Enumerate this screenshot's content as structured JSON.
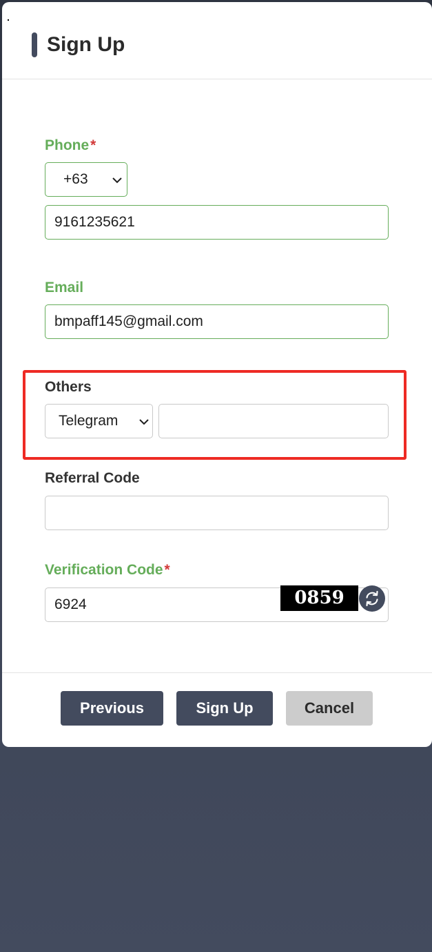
{
  "dialog": {
    "title": "Sign Up"
  },
  "form": {
    "phone": {
      "label": "Phone",
      "required_mark": "*",
      "country_code": "+63",
      "value": "9161235621"
    },
    "email": {
      "label": "Email",
      "value": "bmpaff145@gmail.com"
    },
    "others": {
      "label": "Others",
      "selected_type": "Telegram",
      "value": ""
    },
    "referral": {
      "label": "Referral Code",
      "value": ""
    },
    "verification": {
      "label": "Verification Code",
      "required_mark": "*",
      "value": "6924",
      "captcha_text": "0859"
    }
  },
  "buttons": {
    "previous": "Previous",
    "sign_up": "Sign Up",
    "cancel": "Cancel"
  },
  "colors": {
    "accent_green": "#65ad5a",
    "primary_button": "#434b5e",
    "secondary_button": "#cccccc",
    "highlight_red": "#ee2a24",
    "required_red": "#d23a3a"
  },
  "icons": {
    "refresh": "refresh-icon",
    "dropdown": "chevron-down-icon"
  }
}
